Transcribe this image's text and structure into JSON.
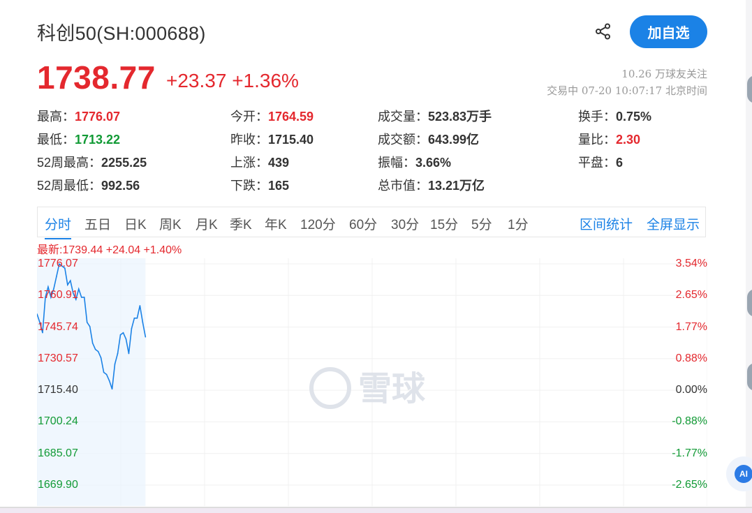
{
  "header": {
    "title": "科创50(SH:000688)",
    "follow_button": "加自选",
    "price": "1738.77",
    "change": "+23.37",
    "change_pct": "+1.36%",
    "followers": "10.26 万球友关注",
    "status": "交易中 07-20 10:07:17 北京时间"
  },
  "quote": {
    "col1": [
      {
        "label": "最高：",
        "value": "1776.07",
        "tone": "red"
      },
      {
        "label": "最低：",
        "value": "1713.22",
        "tone": "green"
      },
      {
        "label": "52周最高：",
        "value": "2255.25",
        "tone": "black"
      },
      {
        "label": "52周最低：",
        "value": "992.56",
        "tone": "black"
      }
    ],
    "col2": [
      {
        "label": "今开：",
        "value": "1764.59",
        "tone": "red"
      },
      {
        "label": "昨收：",
        "value": "1715.40",
        "tone": "black"
      },
      {
        "label": "上涨：",
        "value": "439",
        "tone": "black"
      },
      {
        "label": "下跌：",
        "value": "165",
        "tone": "black"
      }
    ],
    "col3": [
      {
        "label": "成交量：",
        "value": "523.83万手",
        "tone": "black"
      },
      {
        "label": "成交额：",
        "value": "643.99亿",
        "tone": "black"
      },
      {
        "label": "振幅：",
        "value": "3.66%",
        "tone": "black"
      },
      {
        "label": "总市值：",
        "value": "13.21万亿",
        "tone": "black"
      }
    ],
    "col4": [
      {
        "label": "换手：",
        "value": "0.75%",
        "tone": "black"
      },
      {
        "label": "量比：",
        "value": "2.30",
        "tone": "red"
      },
      {
        "label": "平盘：",
        "value": "6",
        "tone": "black"
      }
    ]
  },
  "tabs": {
    "items": [
      "分时",
      "五日",
      "日K",
      "周K",
      "月K",
      "季K",
      "年K",
      "120分",
      "60分",
      "30分",
      "15分",
      "5分",
      "1分"
    ],
    "active": "分时",
    "range_stats": "区间统计",
    "fullscreen": "全屏显示"
  },
  "chart_latest": "最新:1739.44 +24.04 +1.40%",
  "watermark": "雪球",
  "ai_button": "AI",
  "colors": {
    "up": "#e4282e",
    "down": "#119a35",
    "accent": "#1b82e6",
    "line": "#1b82e6"
  },
  "chart_data": {
    "type": "line",
    "title": "",
    "xlabel": "",
    "ylabel": "",
    "prev_close": 1715.4,
    "ylim": [
      1669.9,
      1776.07
    ],
    "y_ticks": [
      "1776.07",
      "1760.91",
      "1745.74",
      "1730.57",
      "1715.40",
      "1700.24",
      "1685.07",
      "1669.90"
    ],
    "y_ticks_right": [
      "3.54%",
      "2.65%",
      "1.77%",
      "0.88%",
      "0.00%",
      "-0.88%",
      "-1.77%",
      "-2.65%"
    ],
    "series": [
      {
        "values": [
          1752,
          1748,
          1743,
          1760,
          1765,
          1760,
          1764,
          1770,
          1776,
          1775,
          1774,
          1766,
          1768,
          1762,
          1759,
          1764,
          1760,
          1760,
          1748,
          1746,
          1738,
          1735,
          1734,
          1731,
          1724,
          1723,
          1720,
          1716,
          1728,
          1733,
          1742,
          1743,
          1740,
          1733,
          1745,
          1750,
          1750,
          1756,
          1748,
          1741
        ]
      }
    ],
    "total_points": 242
  }
}
